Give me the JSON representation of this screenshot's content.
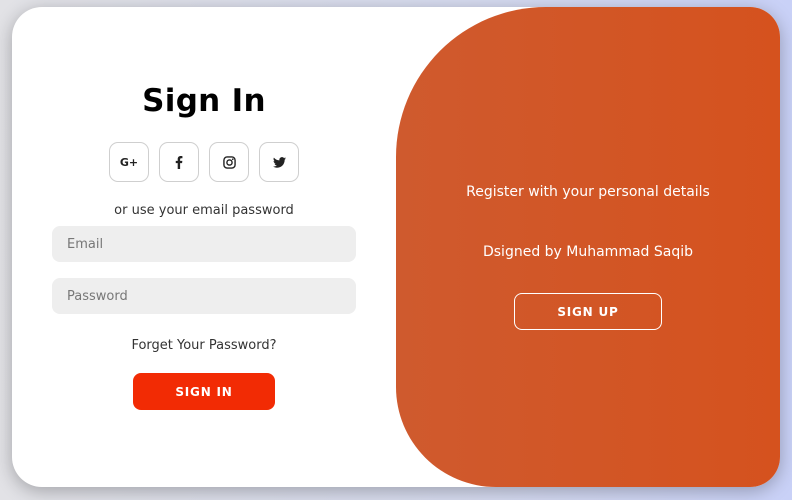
{
  "signin": {
    "title": "Sign In",
    "divider_text": "or use your email password",
    "email_placeholder": "Email",
    "password_placeholder": "Password",
    "forgot_label": "Forget Your Password?",
    "button_label": "SIGN IN"
  },
  "socials": [
    {
      "icon": "google-plus-icon",
      "glyph": "G+"
    },
    {
      "icon": "facebook-icon"
    },
    {
      "icon": "instagram-icon"
    },
    {
      "icon": "twitter-icon"
    }
  ],
  "panel": {
    "register_text": "Register with your personal details",
    "designer_text": "Dsigned by Muhammad Saqib",
    "button_label": "SIGN UP"
  },
  "colors": {
    "accent": "#f22b04",
    "panel": "#d5521e",
    "input_bg": "#eeeeee"
  }
}
